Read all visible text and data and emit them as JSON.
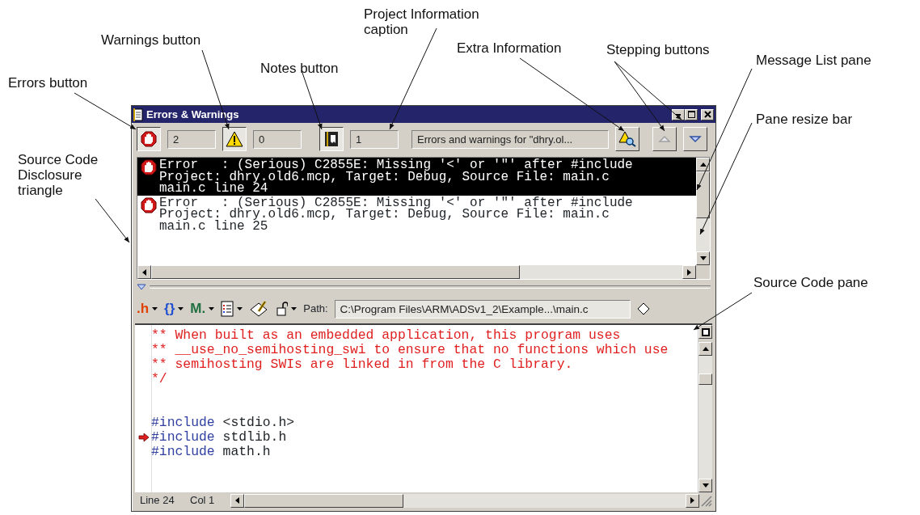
{
  "callouts": [
    {
      "text": "Errors button"
    },
    {
      "text": "Warnings button"
    },
    {
      "text": "Notes button"
    },
    {
      "text": "Project Information caption"
    },
    {
      "text": "Extra Information"
    },
    {
      "text": "Stepping buttons"
    },
    {
      "text": "Message List pane"
    },
    {
      "text": "Source Code Disclosure triangle"
    },
    {
      "text": "Pane resize bar"
    },
    {
      "text": "Source Code pane"
    }
  ],
  "window": {
    "title": "Errors & Warnings"
  },
  "toolbar": {
    "errors": {
      "count": "2",
      "pressed": true
    },
    "warnings": {
      "count": "0",
      "pressed": true
    },
    "notes": {
      "count": "1",
      "pressed": true
    },
    "project_info": "Errors and warnings for \"dhry.ol...",
    "step_up": {
      "disabled": true
    },
    "step_down": {
      "disabled": false
    }
  },
  "messages": [
    {
      "selected": true,
      "lines": [
        "Error   : (Serious) C2855E: Missing '<' or '\"' after #include",
        "Project: dhry.old6.mcp, Target: Debug, Source File: main.c",
        "main.c line 24"
      ]
    },
    {
      "selected": false,
      "lines": [
        "Error   : (Serious) C2855E: Missing '<' or '\"' after #include",
        "Project: dhry.old6.mcp, Target: Debug, Source File: main.c",
        "main.c line 25"
      ]
    }
  ],
  "source_toolbar": {
    "menus": [
      {
        "glyph": ".h"
      },
      {
        "glyph": "{}"
      },
      {
        "glyph": "M."
      }
    ],
    "path_label": "Path:",
    "path": "C:\\Program Files\\ARM\\ADSv1_2\\Example...\\main.c"
  },
  "code_lines": [
    {
      "kind": "comment",
      "text": "** When built as an embedded application, this program uses",
      "marker": false
    },
    {
      "kind": "comment",
      "text": "** __use_no_semihosting_swi to ensure that no functions which use",
      "marker": false
    },
    {
      "kind": "comment",
      "text": "** semihosting SWIs are linked in from the C library.",
      "marker": false
    },
    {
      "kind": "comment",
      "text": "*/",
      "marker": false
    },
    {
      "kind": "blank",
      "marker": false
    },
    {
      "kind": "blank",
      "marker": false
    },
    {
      "kind": "include",
      "keyword": "#include",
      "text": " <stdio.h>",
      "marker": false
    },
    {
      "kind": "include",
      "keyword": "#include",
      "text": " stdlib.h",
      "marker": true
    },
    {
      "kind": "include",
      "keyword": "#include",
      "text": " math.h",
      "marker": false
    }
  ],
  "status_bar": {
    "line": "Line 24",
    "col": "Col 1"
  }
}
